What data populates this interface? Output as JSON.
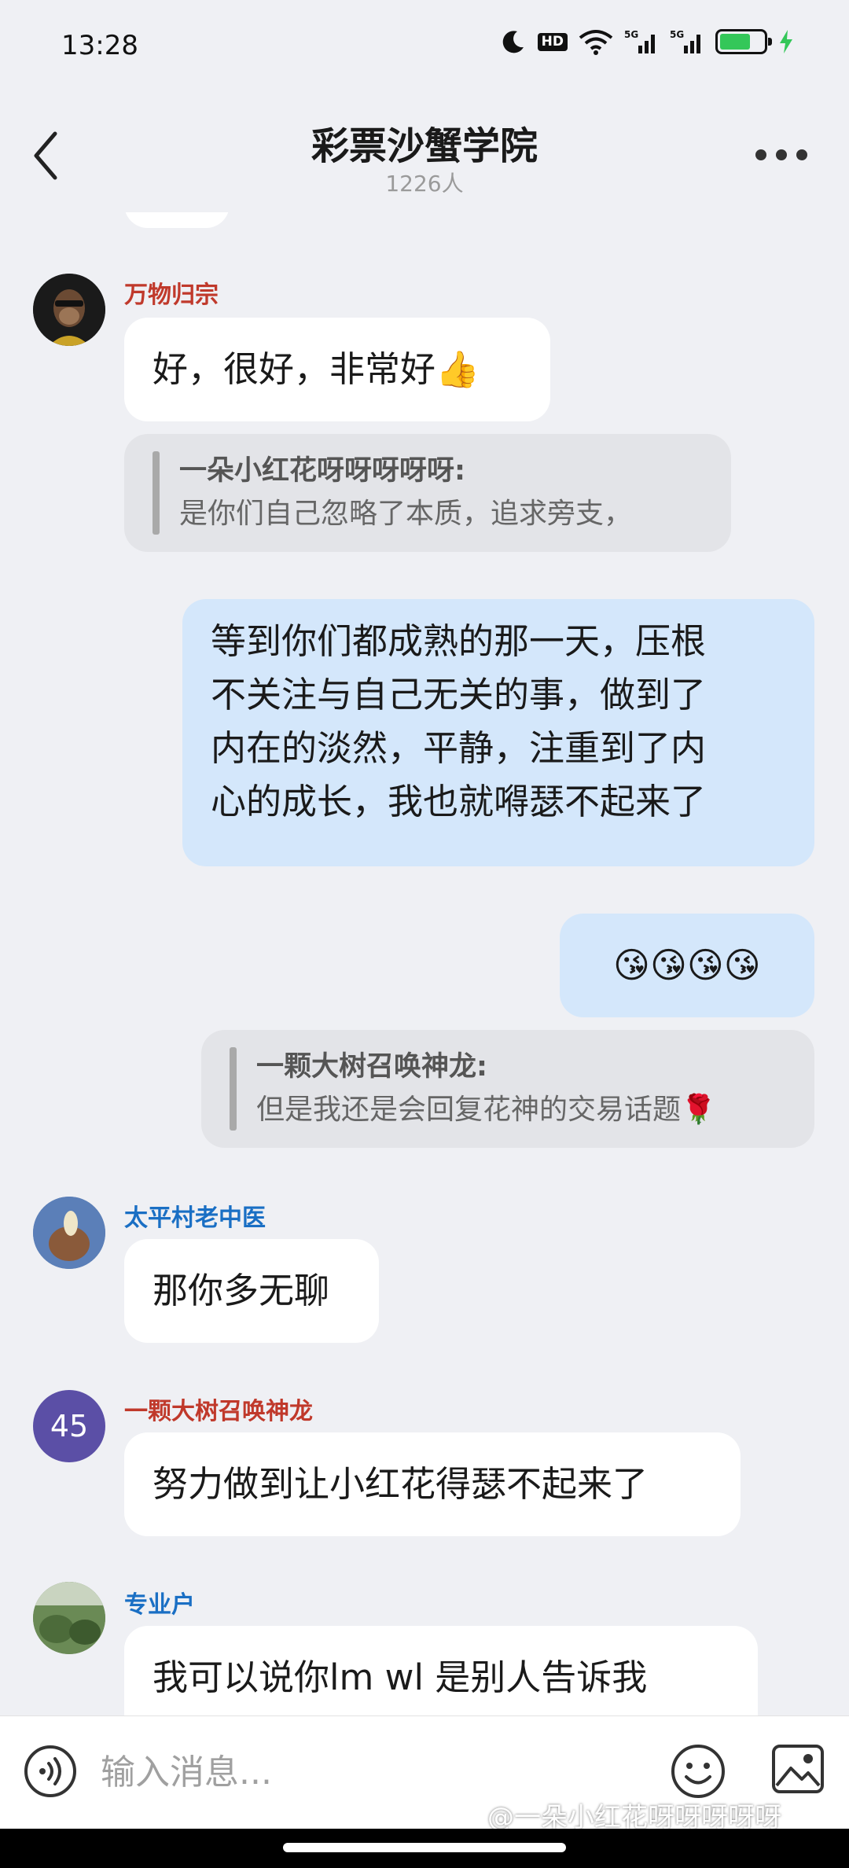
{
  "status_bar": {
    "time": "13:28",
    "icons": [
      "moon-icon",
      "hd-icon",
      "wifi-icon",
      "signal-5g-icon",
      "signal-5g-icon",
      "battery-icon",
      "charging-icon"
    ],
    "hd_label": "HD",
    "battery_level": 0.7,
    "battery_color": "#34c759"
  },
  "header": {
    "title": "彩票沙蟹学院",
    "member_count": "1226人",
    "back_icon": "chevron-left-icon",
    "more_icon": "more-horizontal-icon"
  },
  "messages": [
    {
      "sender": "万物归宗",
      "sender_color": "#c0392b",
      "text": "好，很好，非常好👍"
    },
    {
      "sender": "太平村老中医",
      "sender_color": "#1a6fc4",
      "text": "那你多无聊"
    },
    {
      "sender": "一颗大树召唤神龙",
      "sender_color": "#c0392b",
      "avatar_text": "45",
      "avatar_color": "#5b4fa6",
      "text": "努力做到让小红花得瑟不起来了"
    },
    {
      "sender": "专业户",
      "sender_color": "#1a6fc4",
      "text": "我可以说你lm  wl  是别人告诉我"
    }
  ],
  "quotes": [
    {
      "name": "一朵小红花呀呀呀呀呀:",
      "text": "是你们自己忽略了本质，追求旁支，"
    },
    {
      "name": "一颗大树召唤神龙:",
      "text": "但是我还是会回复花神的交易话题🌹"
    }
  ],
  "self_messages": [
    {
      "lines": [
        "等到你们都成熟的那一天，压根",
        "不关注与自己无关的事，做到了",
        "内在的淡然，平静，注重到了内",
        "心的成长，我也就嘚瑟不起来了"
      ]
    },
    {
      "text": "😘😘😘😘"
    }
  ],
  "input_bar": {
    "placeholder": "输入消息...",
    "voice_icon": "voice-icon",
    "emoji_icon": "emoji-icon",
    "image_icon": "image-icon"
  },
  "watermark": "@一朵小红花呀呀呀呀呀",
  "colors": {
    "background": "#eff0f4",
    "self_bubble": "#d4e7fb",
    "other_bubble": "#ffffff",
    "quote_bg": "#e3e4e8"
  }
}
